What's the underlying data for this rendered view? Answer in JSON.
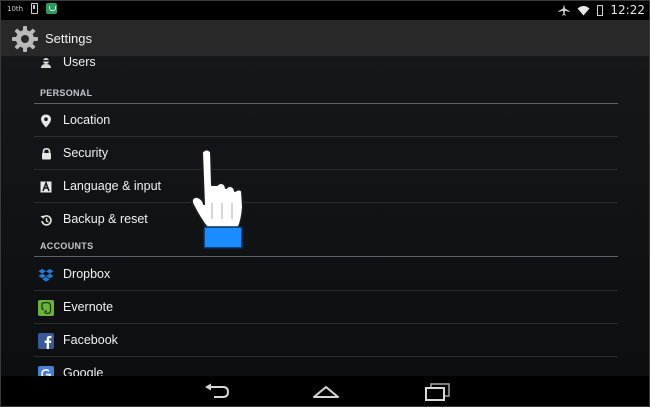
{
  "status_bar": {
    "left_text": "10th",
    "time": "12:22",
    "icons": [
      "phone-icon",
      "shield-icon",
      "airplane-icon",
      "wifi-icon",
      "battery-icon"
    ]
  },
  "action_bar": {
    "title": "Settings",
    "icon": "settings-gear-icon"
  },
  "list": {
    "top_item": {
      "label": "Users",
      "icon": "user-icon"
    },
    "personal_header": "PERSONAL",
    "personal_items": [
      {
        "label": "Location",
        "icon": "location-pin-icon"
      },
      {
        "label": "Security",
        "icon": "lock-icon"
      },
      {
        "label": "Language & input",
        "icon": "language-icon"
      },
      {
        "label": "Backup & reset",
        "icon": "backup-icon"
      }
    ],
    "accounts_header": "ACCOUNTS",
    "account_items": [
      {
        "label": "Dropbox",
        "icon": "dropbox-icon"
      },
      {
        "label": "Evernote",
        "icon": "evernote-icon"
      },
      {
        "label": "Facebook",
        "icon": "facebook-icon"
      },
      {
        "label": "Google",
        "icon": "google-icon"
      }
    ]
  },
  "nav_bar": {
    "buttons": [
      "back-icon",
      "home-icon",
      "recent-apps-icon"
    ]
  },
  "colors": {
    "action_bar": "#282828",
    "section_divider": "#5d6066",
    "dropbox": "#1f7bd6",
    "evernote": "#6cb33e",
    "facebook": "#3b5998",
    "google": "#4a7fd9",
    "pointer_accent": "#1a8cff"
  }
}
